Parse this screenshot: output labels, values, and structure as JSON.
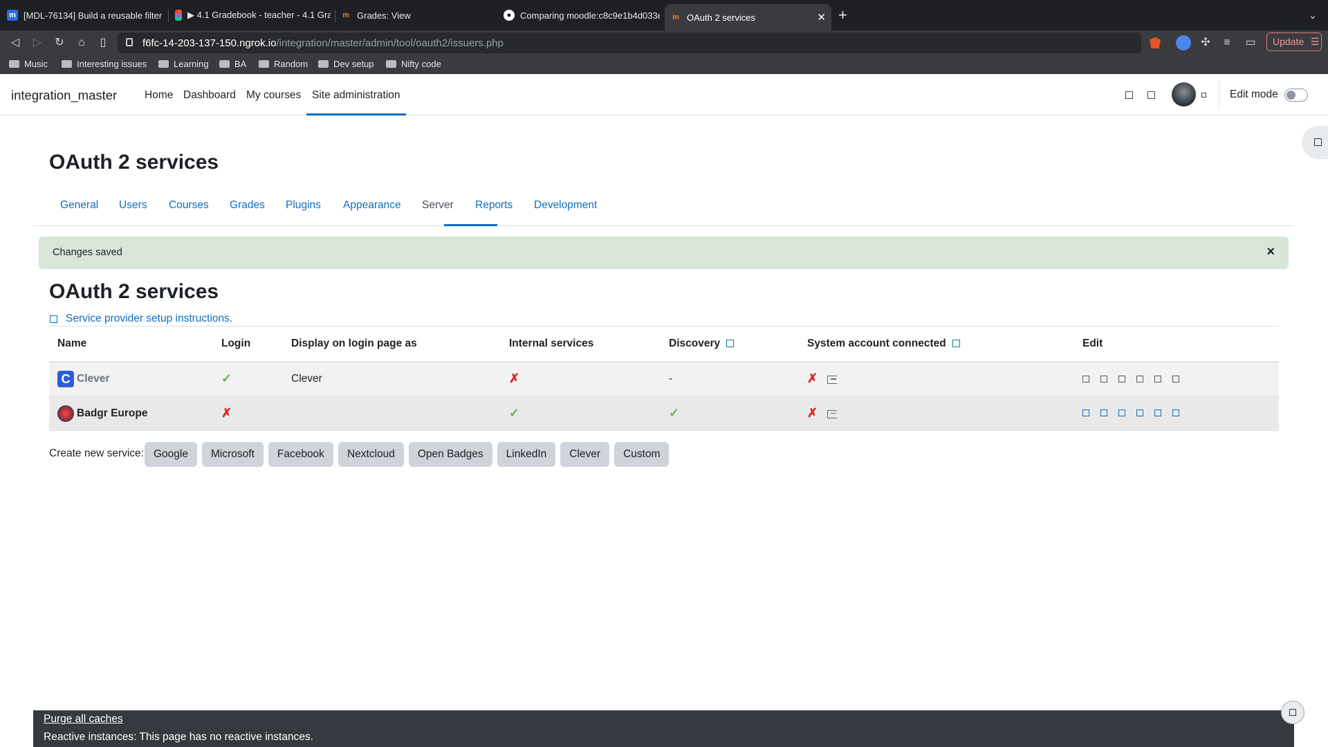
{
  "browser": {
    "tabs": [
      {
        "title": "[MDL-76134] Build a reusable filter",
        "favicon": "m"
      },
      {
        "title": "▶ 4.1 Gradebook - teacher - 4.1 Gra",
        "favicon": "figma"
      },
      {
        "title": "Grades: View",
        "favicon": "m"
      },
      {
        "title": "Comparing moodle:c8c9e1b4d033e",
        "favicon": "github"
      },
      {
        "title": "OAuth 2 services",
        "favicon": "m",
        "active": true
      }
    ],
    "new_tab": "+",
    "url_host": "f6fc-14-203-137-150.ngrok.io",
    "url_path": "/integration/master/admin/tool/oauth2/issuers.php",
    "update_label": "Update",
    "bookmarks": [
      "Music",
      "Interesting issues",
      "Learning",
      "BA",
      "Random",
      "Dev setup",
      "Nifty code"
    ]
  },
  "nav": {
    "site_name": "integration_master",
    "links": [
      "Home",
      "Dashboard",
      "My courses",
      "Site administration"
    ],
    "active": "Site administration",
    "edit_mode_label": "Edit mode"
  },
  "page": {
    "title": "OAuth 2 services",
    "tabs": [
      "General",
      "Users",
      "Courses",
      "Grades",
      "Plugins",
      "Appearance",
      "Server",
      "Reports",
      "Development"
    ],
    "active_tab": "Server",
    "alert": "Changes saved",
    "alert_close": "×",
    "subtitle": "OAuth 2 services",
    "setup_link": "Service provider setup instructions."
  },
  "table": {
    "headers": [
      "Name",
      "Login",
      "Display on login page as",
      "Internal services",
      "Discovery",
      "System account connected",
      "Edit"
    ],
    "rows": [
      {
        "name": "Clever",
        "login": "✓",
        "display": "Clever",
        "internal": "✗",
        "discovery": "-",
        "system": "✗"
      },
      {
        "name": "Badgr Europe",
        "login": "✗",
        "display": "",
        "internal": "✓",
        "discovery": "✓",
        "system": "✗"
      }
    ]
  },
  "create": {
    "label": "Create new service:",
    "buttons": [
      "Google",
      "Microsoft",
      "Facebook",
      "Nextcloud",
      "Open Badges",
      "LinkedIn",
      "Clever",
      "Custom"
    ]
  },
  "footer": {
    "purge": "Purge all caches",
    "reactive": "Reactive instances: This page has no reactive instances."
  },
  "colors": {
    "primary": "#0f6cbf",
    "success_bg": "#d7e6d9",
    "check": "#6ab04c",
    "cross": "#e02424",
    "footer_bg": "#343a40"
  }
}
